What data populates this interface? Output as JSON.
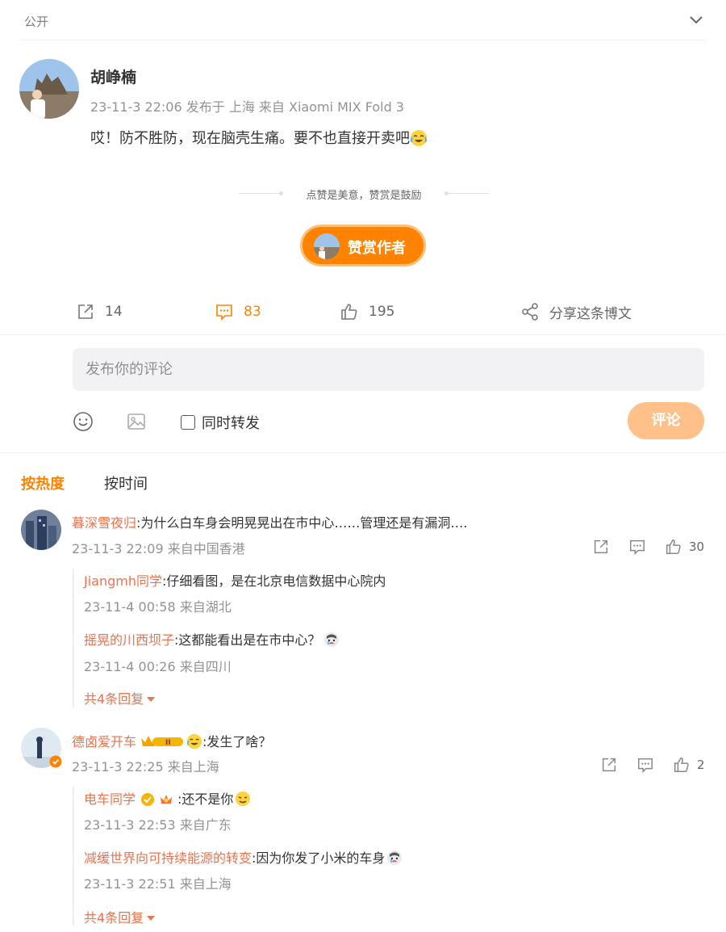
{
  "header": {
    "visibility": "公开"
  },
  "post": {
    "author": "胡峥楠",
    "time": "23-11-3 22:06",
    "location": "发布于 上海",
    "device": "来自 Xiaomi MIX Fold 3",
    "text": "哎！防不胜防，现在脑壳生痛。要不也直接开卖吧",
    "reward_tip": "点赞是美意，赞赏是鼓励",
    "reward_button": "赞赏作者"
  },
  "actions": {
    "reposts": "14",
    "comments": "83",
    "likes": "195",
    "share": "分享这条博文"
  },
  "composer": {
    "placeholder": "发布你的评论",
    "repost_label": "同时转发",
    "submit": "评论"
  },
  "sort": {
    "hot": "按热度",
    "time": "按时间"
  },
  "comments": [
    {
      "user": "暮深雪夜归",
      "text": ":为什么白车身会明晃晃出在市中心……管理还是有漏洞….",
      "meta": "23-11-3 22:09 来自中国香港",
      "likes": "30",
      "replies": [
        {
          "user": "Jiangmh同学",
          "text": ":仔细看图，是在北京电信数据中心院内",
          "meta": "23-11-4 00:58 来自湖北"
        },
        {
          "user": "摇晃的川西坝子",
          "text": ":这都能看出是在市中心？",
          "meta": "23-11-4 00:26 来自四川"
        }
      ],
      "more": "共4条回复"
    },
    {
      "user": "德卤爱开车",
      "text": ":发生了啥？",
      "meta": "23-11-3 22:25 来自上海",
      "likes": "2",
      "replies": [
        {
          "user": "电车同学",
          "text": ":还不是你",
          "meta": "23-11-3 22:53 来自广东"
        },
        {
          "user": "减缓世界向可持续能源的转变",
          "text": ":因为你发了小米的车身",
          "meta": "23-11-3 22:51 来自上海"
        }
      ],
      "more": "共4条回复"
    }
  ],
  "colors": {
    "accent": "#ff8200",
    "username": "#eb7350",
    "muted": "#939393"
  }
}
